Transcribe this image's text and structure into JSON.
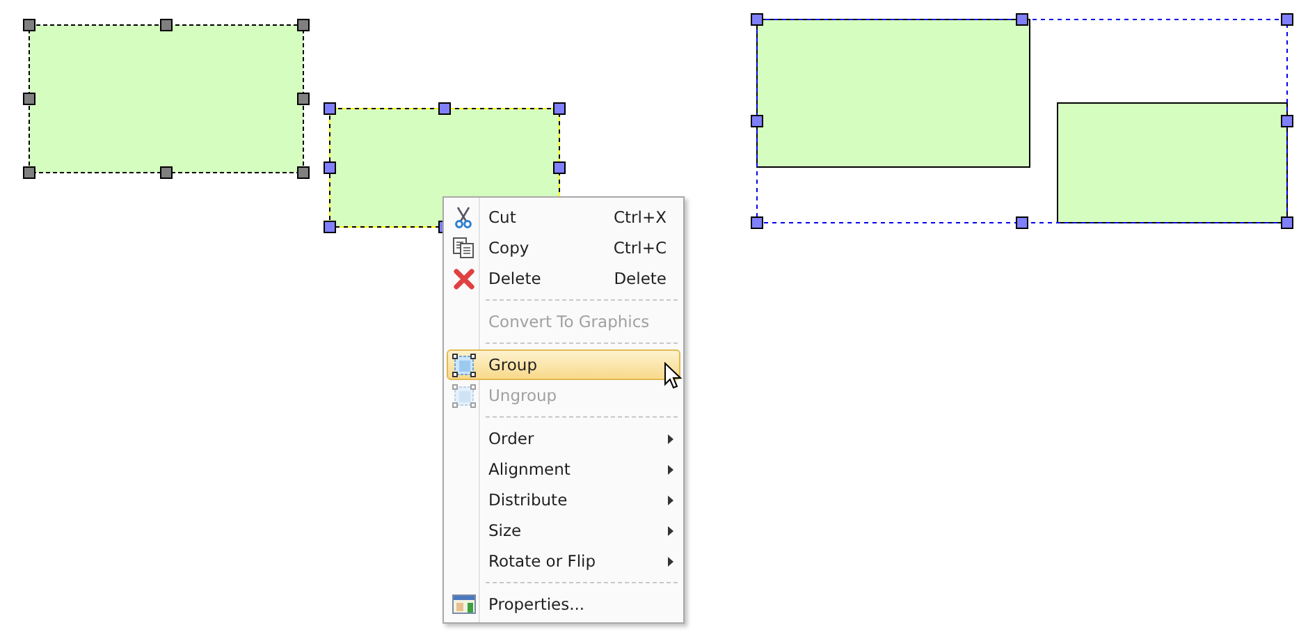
{
  "context_menu": {
    "items": [
      {
        "kind": "item",
        "label": "Cut",
        "shortcut": "Ctrl+X",
        "disabled": false,
        "selected": false,
        "submenu": false
      },
      {
        "kind": "item",
        "label": "Copy",
        "shortcut": "Ctrl+C",
        "disabled": false,
        "selected": false,
        "submenu": false
      },
      {
        "kind": "item",
        "label": "Delete",
        "shortcut": "Delete",
        "disabled": false,
        "selected": false,
        "submenu": false
      },
      {
        "kind": "separator"
      },
      {
        "kind": "item",
        "label": "Convert To Graphics",
        "disabled": true,
        "selected": false,
        "submenu": false
      },
      {
        "kind": "separator"
      },
      {
        "kind": "item",
        "label": "Group",
        "disabled": false,
        "selected": true,
        "submenu": false
      },
      {
        "kind": "item",
        "label": "Ungroup",
        "disabled": true,
        "selected": false,
        "submenu": false
      },
      {
        "kind": "separator"
      },
      {
        "kind": "item",
        "label": "Order",
        "disabled": false,
        "selected": false,
        "submenu": true
      },
      {
        "kind": "item",
        "label": "Alignment",
        "disabled": false,
        "selected": false,
        "submenu": true
      },
      {
        "kind": "item",
        "label": "Distribute",
        "disabled": false,
        "selected": false,
        "submenu": true
      },
      {
        "kind": "item",
        "label": "Size",
        "disabled": false,
        "selected": false,
        "submenu": true
      },
      {
        "kind": "item",
        "label": "Rotate or Flip",
        "disabled": false,
        "selected": false,
        "submenu": true
      },
      {
        "kind": "separator"
      },
      {
        "kind": "item",
        "label": "Properties...",
        "disabled": false,
        "selected": false,
        "submenu": false
      }
    ]
  }
}
